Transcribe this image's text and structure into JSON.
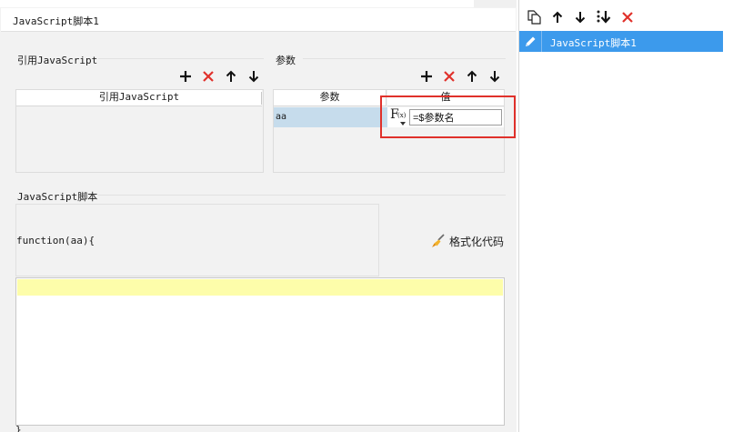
{
  "tab": {
    "title": "JavaScript脚本1"
  },
  "reference": {
    "section_title": "引用JavaScript",
    "column_header": "引用JavaScript"
  },
  "params": {
    "section_title": "参数",
    "col_name": "参数",
    "col_value": "值",
    "rows": [
      {
        "name": "aa",
        "value": "=$参数名"
      }
    ],
    "formula_label": "F",
    "formula_sub": "(x)"
  },
  "script": {
    "section_title": "JavaScript脚本",
    "function_signature": "function(aa){",
    "format_button": "格式化代码",
    "closing_brace": "}"
  },
  "right_panel": {
    "items": [
      {
        "label": "JavaScript脚本1"
      }
    ]
  },
  "colors": {
    "add": "#111111",
    "delete": "#e0312b",
    "selection": "#3c9aec",
    "highlight_box": "#e0312b",
    "code_line": "#fdfdaa"
  }
}
